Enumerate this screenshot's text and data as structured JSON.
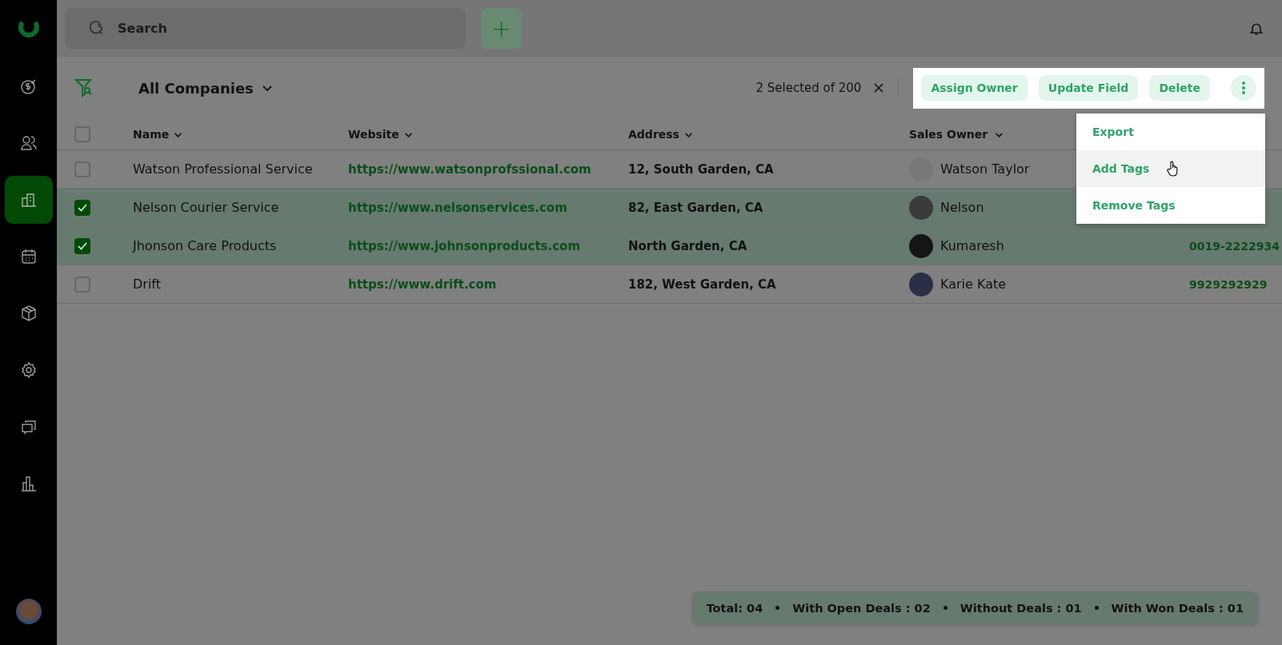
{
  "sidebar": {
    "items": [
      {
        "kind": "money",
        "selected": false
      },
      {
        "kind": "people",
        "selected": false
      },
      {
        "kind": "building",
        "selected": true
      },
      {
        "kind": "calendar",
        "selected": false
      },
      {
        "kind": "box",
        "selected": false
      },
      {
        "kind": "gear",
        "selected": false
      },
      {
        "kind": "chat",
        "selected": false
      },
      {
        "kind": "chart",
        "selected": false
      }
    ]
  },
  "topbar": {
    "search": {
      "placeholder": "Search"
    },
    "add_button": "+"
  },
  "toolbar": {
    "view_title": "All Companies",
    "selection": "2 Selected of 200",
    "actions": [
      "Assign Owner",
      "Update Field",
      "Delete"
    ]
  },
  "menu": {
    "items": [
      {
        "label": "Export",
        "highlighted": false
      },
      {
        "label": "Add Tags",
        "highlighted": true
      },
      {
        "label": "Remove Tags",
        "highlighted": false
      }
    ]
  },
  "table": {
    "all_checked": false,
    "columns": [
      "Name",
      "Website",
      "Address",
      "Sales Owner"
    ],
    "rows": [
      {
        "selected": false,
        "name": "Watson Professional Service",
        "website": "https://www.watsonprofssional.com",
        "address": "12, South Garden, CA",
        "owner": "Watson Taylor"
      },
      {
        "selected": true,
        "name": "Nelson Courier Service",
        "website": "https://www.nelsonservices.com",
        "address": "82, East Garden, CA",
        "owner": "Nelson"
      },
      {
        "selected": true,
        "name": "Jhonson Care Products",
        "website": "https://www.johnsonproducts.com",
        "address": "North Garden, CA",
        "owner": "Kumaresh",
        "column_5": "0019-2222934"
      },
      {
        "selected": false,
        "name": "Drift",
        "website": "https://www.drift.com",
        "address": "182, West Garden, CA",
        "owner": "Karie Kate",
        "column_5": "9929292929"
      }
    ]
  },
  "summary": [
    "Total: 04",
    "With Open Deals : 02",
    "Without Deals : 01",
    "With Won Deals : 01"
  ]
}
